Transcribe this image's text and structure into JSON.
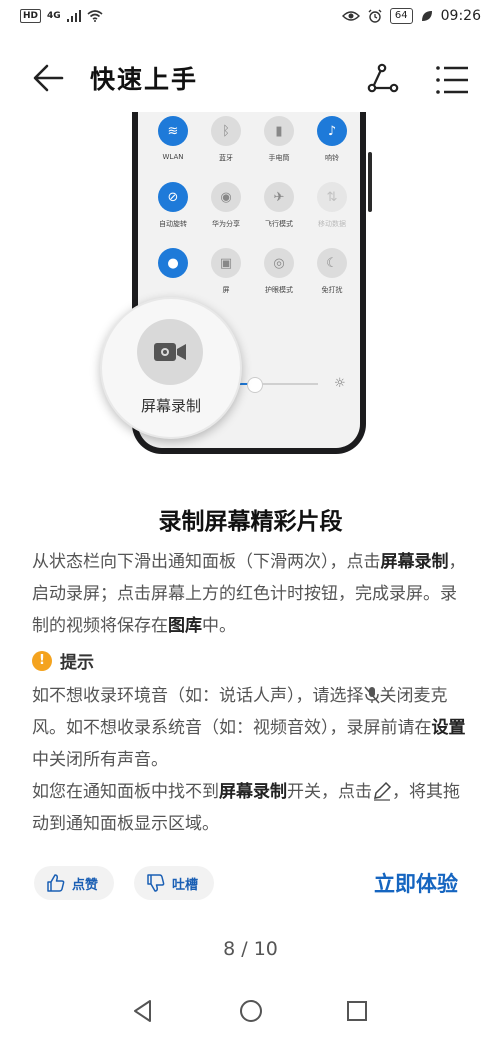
{
  "status_bar": {
    "left_badge": "HD",
    "network": "4G",
    "battery": "64",
    "time": "09:26"
  },
  "app_bar": {
    "title": "快速上手",
    "icons": [
      "back-arrow-icon",
      "share-icon",
      "menu-icon"
    ]
  },
  "illustration": {
    "tiles": [
      {
        "label": "WLAN",
        "icon": "wifi-icon",
        "state": "on"
      },
      {
        "label": "蓝牙",
        "icon": "bluetooth-icon",
        "state": "off"
      },
      {
        "label": "手电筒",
        "icon": "flashlight-icon",
        "state": "off"
      },
      {
        "label": "响铃",
        "icon": "bell-icon",
        "state": "on"
      },
      {
        "label": "自动旋转",
        "icon": "rotate-icon",
        "state": "on"
      },
      {
        "label": "华为分享",
        "icon": "huawei-share-icon",
        "state": "off"
      },
      {
        "label": "飞行模式",
        "icon": "airplane-icon",
        "state": "off"
      },
      {
        "label": "移动数据",
        "icon": "mobile-data-icon",
        "state": "dim"
      },
      {
        "label": "",
        "icon": "location-icon",
        "state": "on"
      },
      {
        "label": "屏",
        "icon": "screenshot-icon",
        "state": "off"
      },
      {
        "label": "护眼模式",
        "icon": "eye-icon",
        "state": "off"
      },
      {
        "label": "免打扰",
        "icon": "moon-icon",
        "state": "off"
      }
    ],
    "magnifier_label": "屏幕录制",
    "brightness_level": 0.3
  },
  "article": {
    "heading": "录制屏幕精彩片段",
    "p1_a": "从状态栏向下滑出通知面板（下滑两次），点击",
    "p1_b": "屏幕录制",
    "p1_c": "，启动录屏；点击屏幕上方的红色计时按钮，完成录屏。录制的视频将保存在",
    "p1_d": "图库",
    "p1_e": "中。",
    "tip_title": "提示",
    "p2_a": "如不想收录环境音（如：说话人声），请选择",
    "p2_b": "关闭麦克风。如不想收录系统音（如：视频音效），录屏前请在",
    "p2_c": "设置",
    "p2_d": "中关闭所有声音。",
    "p3_a": "如您在通知面板中找不到",
    "p3_b": "屏幕录制",
    "p3_c": "开关，点击",
    "p3_d": "，将其拖动到通知面板显示区域。"
  },
  "actions": {
    "like_label": "点赞",
    "dislike_label": "吐槽",
    "try_label": "立即体验"
  },
  "pager": {
    "indicator": "8 / 10"
  },
  "colors": {
    "accent": "#1565c0",
    "tile_on": "#1e7ad9",
    "tip_icon": "#f4a31f"
  }
}
